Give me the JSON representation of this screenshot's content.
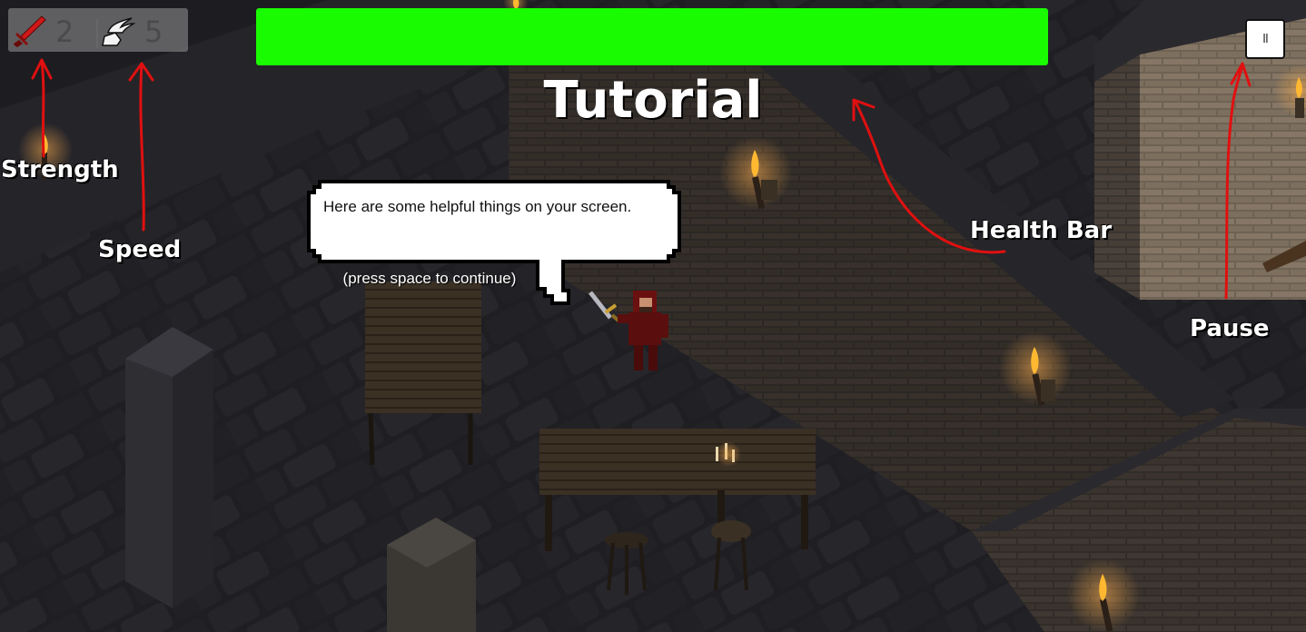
{
  "hud": {
    "strength": {
      "icon": "sword-icon",
      "value": "2"
    },
    "speed": {
      "icon": "winged-boot-icon",
      "value": "5"
    },
    "health": {
      "fraction": 1.0,
      "color": "#19fb00"
    },
    "pause": {
      "icon": "pause-icon",
      "glyph": "II"
    }
  },
  "title": "Tutorial",
  "annotations": {
    "strength": "Strength",
    "speed": "Speed",
    "health_bar": "Health Bar",
    "pause": "Pause"
  },
  "dialog": {
    "text": "Here are some helpful things on your screen.",
    "hint": "(press space to continue)"
  },
  "colors": {
    "annotation_arrow": "#e01010",
    "health_fill": "#19fb00"
  }
}
